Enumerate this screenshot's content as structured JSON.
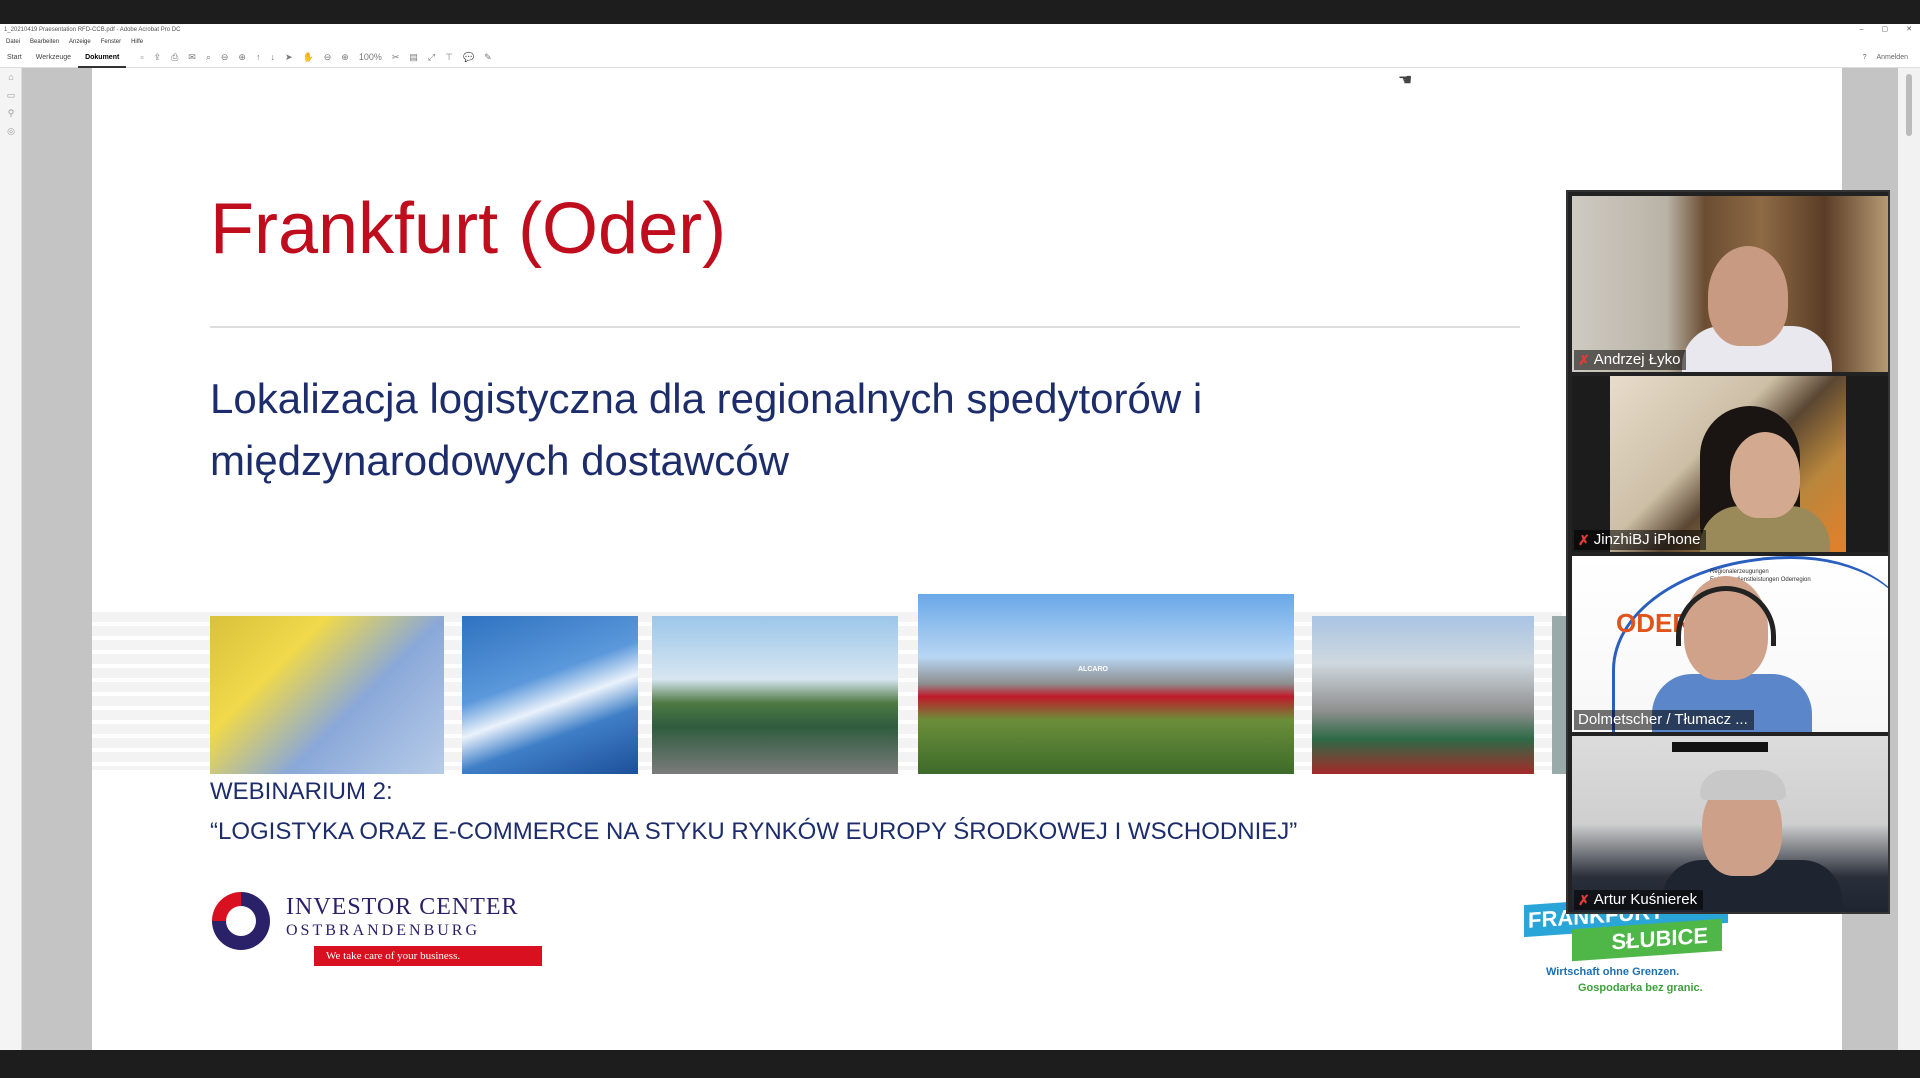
{
  "window": {
    "title": "1_20210419 Praesentation RFD-CCB.pdf - Adobe Acrobat Pro DC",
    "controls": [
      "–",
      "▢",
      "✕"
    ]
  },
  "menu": [
    "Datei",
    "Bearbeiten",
    "Anzeige",
    "Fenster",
    "Hilfe"
  ],
  "toolbar": {
    "tabs": [
      "Start",
      "Werkzeuge",
      "Dokument"
    ],
    "active_tab": "Dokument",
    "zoom": "100%",
    "signin": "Anmelden"
  },
  "slide": {
    "title": "Frankfurt (Oder)",
    "subtitle": "Lokalizacja logistyczna dla regionalnych spedytorów i międzynarodowych dostawców",
    "webinar_heading": "WEBINARIUM 2:",
    "webinar_topic": "“LOGISTYKA ORAZ E-COMMERCE NA STYKU RYNKÓW EUROPY ŚRODKOWEJ I WSCHODNIEJ”",
    "photo_brand_label": "ALCARO",
    "investor_center": {
      "name": "INVESTOR CENTER",
      "region": "OSTBRANDENBURG",
      "tagline": "We take care of your business."
    },
    "frankfurt_slubice": {
      "top": "FRANKFURT",
      "bottom": "SŁUBICE",
      "tagline_de": "Wirtschaft ohne Grenzen.",
      "tagline_pl": "Gospodarka bez granic."
    }
  },
  "participants": [
    {
      "name": "Andrzej Łyko",
      "muted": true
    },
    {
      "name": "JinzhiBJ iPhone",
      "muted": true
    },
    {
      "name": "Dolmetscher / Tłumacz ...",
      "muted": false,
      "slide_text": "ODER",
      "slide_small": "Regionalerzeugungen Erdgasbedienstleistungen Oderregion"
    },
    {
      "name": "Artur Kuśnierek",
      "muted": true
    }
  ],
  "colors": {
    "title_red": "#c00d1e",
    "text_navy": "#1d2d6b",
    "mute_red": "#e53935"
  }
}
